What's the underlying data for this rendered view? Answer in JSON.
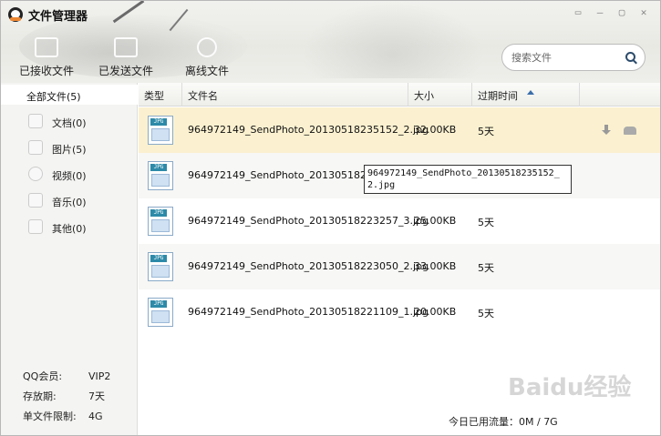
{
  "app": {
    "title": "文件管理器"
  },
  "window_controls": {
    "feedback": "▭",
    "minimize": "—",
    "maximize": "▢",
    "close": "✕"
  },
  "tabs": [
    {
      "label": "已接收文件",
      "icon": "back-arrow-icon"
    },
    {
      "label": "已发送文件",
      "icon": "forward-arrow-icon"
    },
    {
      "label": "离线文件",
      "icon": "clock-icon"
    }
  ],
  "search": {
    "placeholder": "搜索文件"
  },
  "sidebar": {
    "all": "全部文件(5)",
    "items": [
      {
        "label": "文档(0)",
        "icon": "document-icon"
      },
      {
        "label": "图片(5)",
        "icon": "image-icon"
      },
      {
        "label": "视频(0)",
        "icon": "video-icon"
      },
      {
        "label": "音乐(0)",
        "icon": "music-icon"
      },
      {
        "label": "其他(0)",
        "icon": "other-icon"
      }
    ],
    "info": [
      {
        "label": "QQ会员:",
        "value": "VIP2"
      },
      {
        "label": "存放期:",
        "value": "7天"
      },
      {
        "label": "单文件限制:",
        "value": "4G"
      }
    ]
  },
  "columns": {
    "type": "类型",
    "name": "文件名",
    "size": "大小",
    "expire": "过期时间"
  },
  "files": [
    {
      "badge": "JPG",
      "name": "964972149_SendPhoto_20130518235152_2.jpg",
      "size": "32.00KB",
      "expire": "5天"
    },
    {
      "badge": "JPG",
      "name": "964972149_SendPhoto_20130518235021_1.jpg",
      "size": "",
      "expire": ""
    },
    {
      "badge": "JPG",
      "name": "964972149_SendPhoto_20130518223257_3.jpg",
      "size": "25.00KB",
      "expire": "5天"
    },
    {
      "badge": "JPG",
      "name": "964972149_SendPhoto_20130518223050_2.jpg",
      "size": "33.00KB",
      "expire": "5天"
    },
    {
      "badge": "JPG",
      "name": "964972149_SendPhoto_20130518221109_1.jpg",
      "size": "20.00KB",
      "expire": "5天"
    }
  ],
  "tooltip": "964972149_SendPhoto_20130518235152_2.jpg",
  "footer": {
    "traffic": "今日已用流量：0M / 7G"
  },
  "watermark": "Baidu经验"
}
